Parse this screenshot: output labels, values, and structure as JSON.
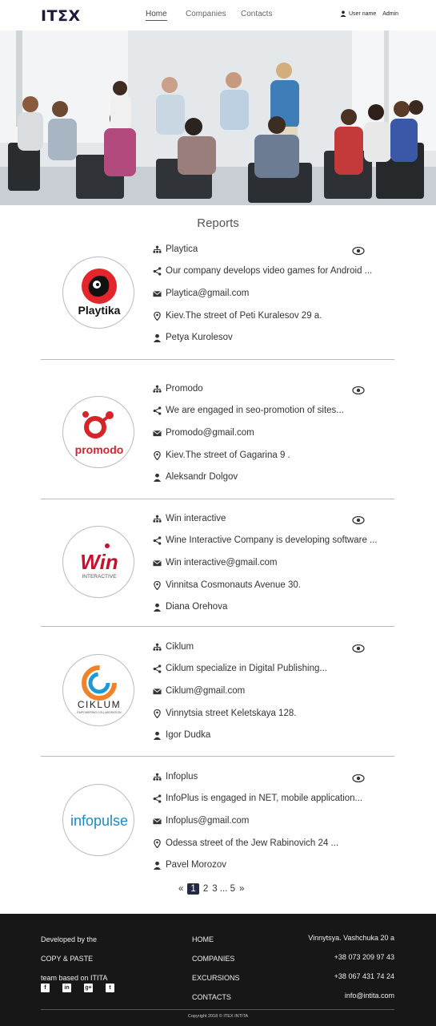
{
  "header": {
    "logo": "ITΣX",
    "nav": [
      "Home",
      "Companies",
      "Contacts"
    ],
    "user_label": "User name",
    "admin_label": "Admin"
  },
  "reports_title": "Reports",
  "companies": [
    {
      "name": "Playtica",
      "description": "Our company develops video games for Android ...",
      "email": "Playtica@gmail.com",
      "address": "Kiev.The street of Peti Kuralesov 29 a.",
      "contact": "Petya Kurolesov",
      "logo_text": "Playtika"
    },
    {
      "name": "Promodo",
      "description": "We are engaged in seo-promotion of sites...",
      "email": "Promodo@gmail.com",
      "address": "Kiev.The street of Gagarina 9 .",
      "contact": "Aleksandr Dolgov",
      "logo_text": "promodo"
    },
    {
      "name": "Win interactive",
      "description": "Wine Interactive Company is developing software ...",
      "email": "Win interactive@gmail.com",
      "address": "Vinnitsa Cosmonauts Avenue 30.",
      "contact": "Diana Orehova",
      "logo_text": "Win",
      "logo_sub": "INTERACTIVE"
    },
    {
      "name": "Ciklum",
      "description": "Ciklum specialize in Digital Publishing...",
      "email": "Ciklum@gmail.com",
      "address": "Vinnytsia street Keletskaya 128.",
      "contact": "Igor Dudka",
      "logo_text": "CIKLUM",
      "logo_sub": "EMPOWERING COLLABORATION"
    },
    {
      "name": "Infoplus",
      "description": "InfoPlus is engaged in NET, mobile application...",
      "email": "Infoplus@gmail.com",
      "address": "Odessa street of the Jew Rabinovich 24 ...",
      "contact": "Pavel Morozov",
      "logo_text": "infopulse"
    }
  ],
  "pagination": {
    "prev": "«",
    "current": "1",
    "p2": "2",
    "p3": "3 ... 5",
    "next": "»"
  },
  "footer": {
    "about": [
      "Developed by the",
      "COPY & PASTE",
      "team based on ITITA"
    ],
    "links": [
      "HOME",
      "COMPANIES",
      "EXCURSIONS",
      "CONTACTS"
    ],
    "contacts": [
      "Vinnytsya. Vashchuka 20 a",
      "+38 073 209 97 43",
      "+38 067 431 74 24",
      "info@intita.com"
    ],
    "social": [
      "f",
      "in",
      "g+",
      "t"
    ],
    "social_icons": [
      "facebook-icon",
      "linkedin-icon",
      "google-plus-icon",
      "twitter-icon"
    ],
    "copyright": "Copyright 2018 © ITEX INTITA"
  },
  "colors": {
    "navy": "#222a44",
    "footer_bg": "#171717",
    "playtika_red": "#e3262c",
    "promodo_red": "#d7232a",
    "ciklum_orange": "#f0832a",
    "ciklum_blue": "#1d9ad6",
    "infopulse_blue": "#1e88c8"
  }
}
